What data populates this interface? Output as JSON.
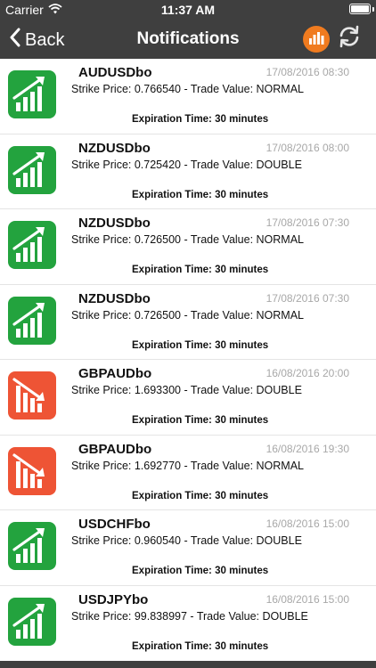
{
  "status_bar": {
    "carrier": "Carrier",
    "time": "11:37 AM",
    "wifi_icon": "wifi-icon",
    "battery_icon": "battery-icon"
  },
  "nav": {
    "back_label": "Back",
    "title": "Notifications",
    "chart_icon": "bar-chart-icon",
    "refresh_icon": "refresh-icon"
  },
  "colors": {
    "header_bg": "#3f3f3f",
    "accent_orange": "#f07b1f",
    "up_green": "#23a33e",
    "down_red": "#ee5435",
    "date_gray": "#a8a8a8"
  },
  "notifications": [
    {
      "symbol": "AUDUSDbo",
      "date": "17/08/2016 08:30",
      "detail": "Strike Price: 0.766540 - Trade Value: NORMAL",
      "expiration": "Expiration Time: 30 minutes",
      "direction": "up"
    },
    {
      "symbol": "NZDUSDbo",
      "date": "17/08/2016 08:00",
      "detail": "Strike Price: 0.725420 - Trade Value: DOUBLE",
      "expiration": "Expiration Time: 30 minutes",
      "direction": "up"
    },
    {
      "symbol": "NZDUSDbo",
      "date": "17/08/2016 07:30",
      "detail": "Strike Price: 0.726500 - Trade Value: NORMAL",
      "expiration": "Expiration Time: 30 minutes",
      "direction": "up"
    },
    {
      "symbol": "NZDUSDbo",
      "date": "17/08/2016 07:30",
      "detail": "Strike Price: 0.726500 - Trade Value: NORMAL",
      "expiration": "Expiration Time: 30 minutes",
      "direction": "up"
    },
    {
      "symbol": "GBPAUDbo",
      "date": "16/08/2016 20:00",
      "detail": "Strike Price: 1.693300 - Trade Value: DOUBLE",
      "expiration": "Expiration Time: 30 minutes",
      "direction": "down"
    },
    {
      "symbol": "GBPAUDbo",
      "date": "16/08/2016 19:30",
      "detail": "Strike Price: 1.692770 - Trade Value: NORMAL",
      "expiration": "Expiration Time: 30 minutes",
      "direction": "down"
    },
    {
      "symbol": "USDCHFbo",
      "date": "16/08/2016 15:00",
      "detail": "Strike Price: 0.960540 - Trade Value: DOUBLE",
      "expiration": "Expiration Time: 30 minutes",
      "direction": "up"
    },
    {
      "symbol": "USDJPYbo",
      "date": "16/08/2016 15:00",
      "detail": "Strike Price: 99.838997 - Trade Value: DOUBLE",
      "expiration": "Expiration Time: 30 minutes",
      "direction": "up"
    }
  ]
}
